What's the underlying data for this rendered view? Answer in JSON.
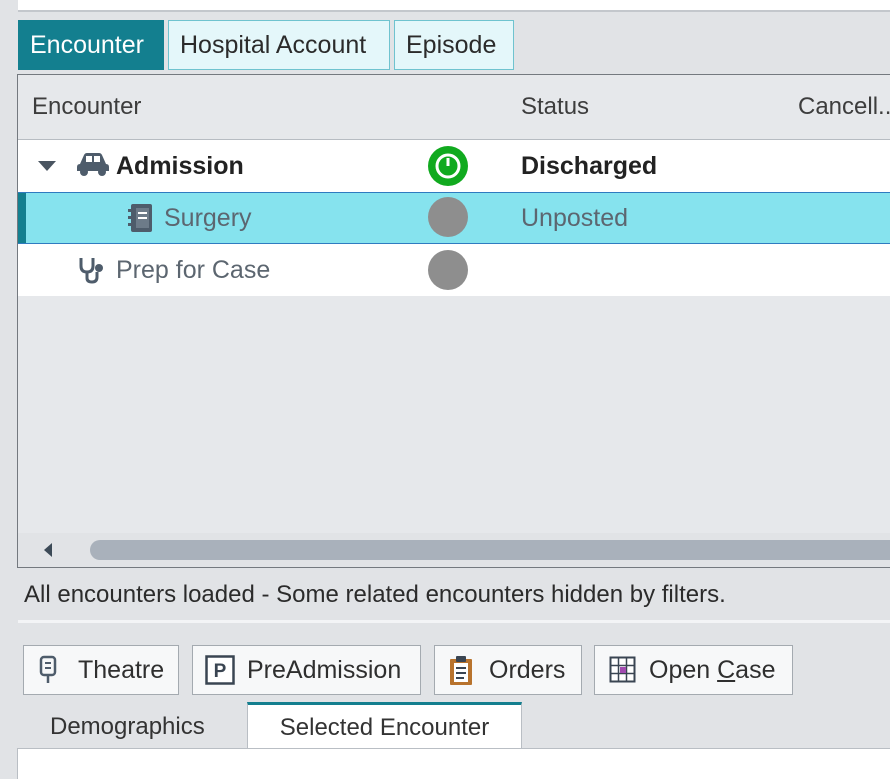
{
  "tabs": [
    {
      "label": "Encounter",
      "active": true
    },
    {
      "label": "Hospital Account",
      "active": false
    },
    {
      "label": "Episode",
      "active": false
    }
  ],
  "grid": {
    "columns": [
      "Encounter",
      "Status",
      "Cancell..."
    ],
    "rows": [
      {
        "icon": "car-icon",
        "name": "Admission",
        "status_icon": "clock-icon",
        "status_color": "#11aa1f",
        "status": "Discharged",
        "expanded": true
      },
      {
        "icon": "notebook-icon",
        "name": "Surgery",
        "status_icon": "grey-circle",
        "status_color": "#8e8e8e",
        "status": "Unposted",
        "selected": true
      },
      {
        "icon": "stethoscope-icon",
        "name": "Prep for Case",
        "status_icon": "grey-circle",
        "status_color": "#8e8e8e",
        "status": ""
      }
    ]
  },
  "status_message": "All encounters loaded - Some related encounters hidden by filters.",
  "actions": {
    "theatre": {
      "label": "Theatre",
      "icon": "iv-bag-icon"
    },
    "preadmission": {
      "label": "PreAdmission",
      "icon": "p-icon"
    },
    "orders": {
      "label": "Orders",
      "icon": "clipboard-icon"
    },
    "open_case": {
      "label_pre": "Open ",
      "label_underlined": "C",
      "label_post": "ase",
      "icon": "grid-icon"
    }
  },
  "bottom_tabs": [
    {
      "label": "Demographics",
      "active": false
    },
    {
      "label": "Selected Encounter",
      "active": true
    }
  ],
  "colors": {
    "accent": "#137f8f",
    "selection": "#86e3ee",
    "status_green": "#11aa1f"
  }
}
